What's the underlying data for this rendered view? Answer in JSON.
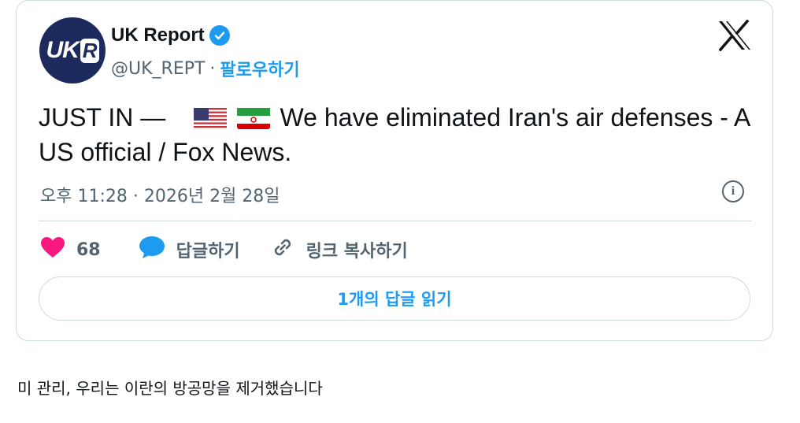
{
  "author": {
    "name": "UK Report",
    "handle": "@UK_REPT",
    "separator": "·",
    "follow_label": "팔로우하기",
    "avatar_text_main": "UK",
    "avatar_text_r": "R"
  },
  "tweet": {
    "text_prefix": "JUST IN  —",
    "text_body": "We have eliminated Iran's air defenses - A US official / Fox News.",
    "timestamp": "오후 11:28 · 2026년 2월 28일"
  },
  "actions": {
    "likes_count": "68",
    "reply_label": "답글하기",
    "copy_link_label": "링크 복사하기"
  },
  "read_replies_label": "1개의 답글 읽기",
  "caption": "미 관리, 우리는 이란의 방공망을 제거했습니다",
  "colors": {
    "accent": "#1d9bf0",
    "heart": "#f91880",
    "muted": "#536471",
    "border": "#cfd9de"
  },
  "icons": [
    "verified-badge-icon",
    "x-logo-icon",
    "us-flag-icon",
    "iran-flag-icon",
    "info-icon",
    "heart-icon",
    "reply-bubble-icon",
    "link-icon"
  ]
}
